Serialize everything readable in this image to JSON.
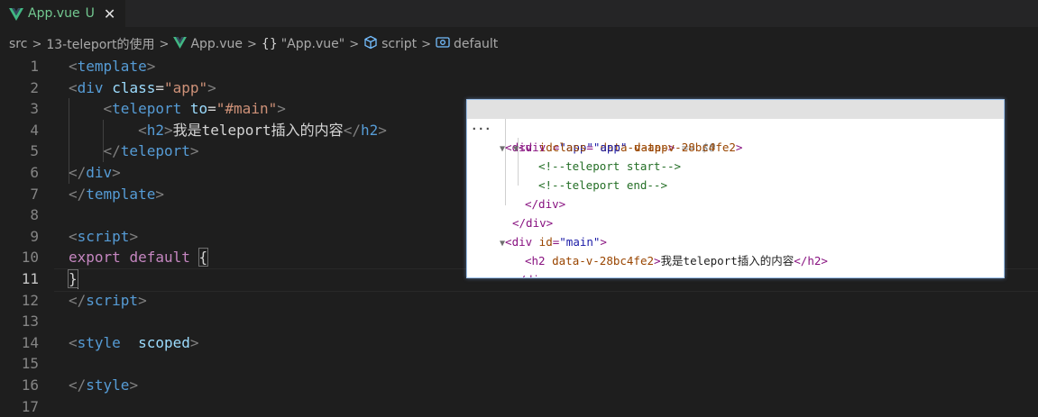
{
  "tab": {
    "filename": "App.vue",
    "status": "U",
    "close": "✕"
  },
  "breadcrumb": {
    "items": [
      {
        "label": "src"
      },
      {
        "label": "13-teleport的使用"
      },
      {
        "label": "App.vue",
        "icon": "vue-icon"
      },
      {
        "label": "\"App.vue\"",
        "icon": "braces-icon",
        "icon_text": "{}"
      },
      {
        "label": "script",
        "icon": "cube-icon"
      },
      {
        "label": "default",
        "icon": "field-icon"
      }
    ],
    "separator": ">"
  },
  "editor": {
    "active_line": 11,
    "lines": [
      {
        "num": "1"
      },
      {
        "num": "2"
      },
      {
        "num": "3"
      },
      {
        "num": "4"
      },
      {
        "num": "5"
      },
      {
        "num": "6"
      },
      {
        "num": "7"
      },
      {
        "num": "8"
      },
      {
        "num": "9"
      },
      {
        "num": "10"
      },
      {
        "num": "11"
      },
      {
        "num": "12"
      },
      {
        "num": "13"
      },
      {
        "num": "14"
      },
      {
        "num": "15"
      },
      {
        "num": "16"
      },
      {
        "num": "17"
      }
    ],
    "tokens": {
      "l1": [
        "<",
        "template",
        ">"
      ],
      "l2": [
        "<",
        "div",
        "class",
        "=",
        "\"app\"",
        ">"
      ],
      "l3": [
        "<",
        "teleport",
        "to",
        "=",
        "\"#main\"",
        ">"
      ],
      "l4": [
        "<",
        "h2",
        ">",
        "我是teleport插入的内容",
        "</",
        "h2",
        ">"
      ],
      "l5": [
        "</",
        "teleport",
        ">"
      ],
      "l6": [
        "</",
        "div",
        ">"
      ],
      "l7": [
        "</",
        "template",
        ">"
      ],
      "l9": [
        "<",
        "script",
        ">"
      ],
      "l10": [
        "export",
        "default",
        "{"
      ],
      "l11": [
        "}"
      ],
      "l12": [
        "</",
        "script",
        ">"
      ],
      "l14": [
        "<",
        "style",
        "scoped",
        ">"
      ],
      "l16": [
        "</",
        "style",
        ">"
      ]
    }
  },
  "devtools": {
    "more": "···",
    "selected_suffix": "== $0",
    "rows": {
      "r1": {
        "tag": "div",
        "attr1": "id",
        "val1": "\"app\"",
        "attr2": "data-v-app"
      },
      "r2": {
        "tag": "div",
        "attr1": "class",
        "val1": "\"app\"",
        "attr2": "data-v-28bc4fe2"
      },
      "r3": {
        "comment": "<!--teleport start-->"
      },
      "r4": {
        "comment": "<!--teleport end-->"
      },
      "r5": {
        "close": "</div>"
      },
      "r6": {
        "close": "</div>"
      },
      "r7": {
        "tag": "div",
        "attr1": "id",
        "val1": "\"main\""
      },
      "r8": {
        "tag": "h2",
        "attr1": "data-v-28bc4fe2",
        "text": "我是teleport插入的内容",
        "close": "</h2>"
      },
      "r9": {
        "close": "</div>"
      }
    }
  },
  "colors": {
    "editor_bg": "#1e1e1e",
    "tag_name": "#569cd6",
    "attr": "#9cdcfe",
    "string": "#ce9178",
    "keyword": "#c586c0",
    "untracked": "#73c991"
  }
}
